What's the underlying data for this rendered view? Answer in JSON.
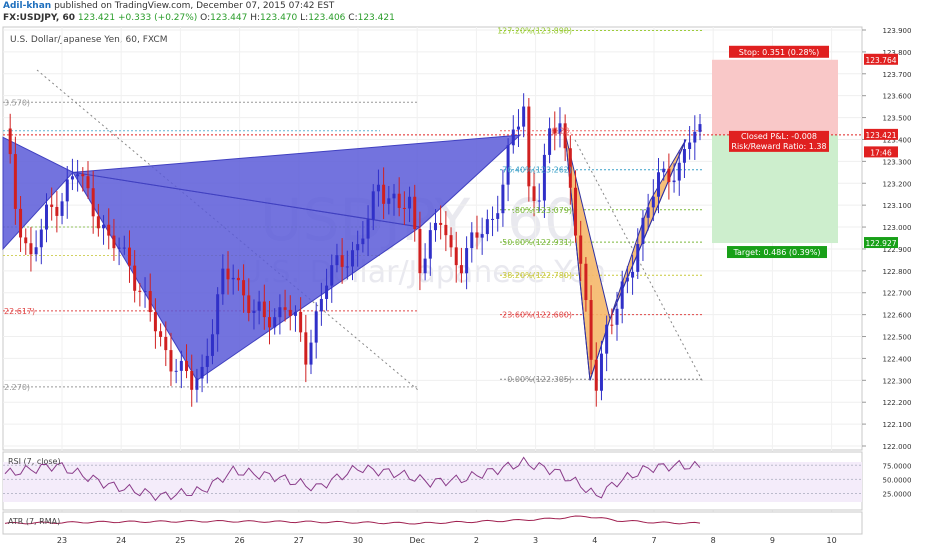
{
  "header": {
    "author": "Adil-khan",
    "published": "published on TradingView.com, December 07, 2015 07:42 EST",
    "symbol": "FX:USDJPY, 60",
    "last": "123.421",
    "change": "+0.333 (+0.27%)",
    "o_label": "O:",
    "o_value": "123.447",
    "h_label": "H:",
    "h_value": "123.470",
    "l_label": "L:",
    "l_value": "123.406",
    "c_label": "C:",
    "c_value": "123.421"
  },
  "chart_title": "U.S. Dollar/Japanese Yen, 60, FXCM",
  "watermark": {
    "symbol": "USDJPY, 60",
    "name": "U.S. Dollar/Japanese Yen"
  },
  "colors": {
    "up": "#3030c8",
    "down": "#d02020",
    "pattern_fill": "#5a5ad8",
    "pattern2_fill": "#f5b86a",
    "stop_zone": "#f9c8c8",
    "target_zone": "#cdeecd",
    "price_line": "#e02020",
    "rsi": "#8a3c8a",
    "atr": "#a02050"
  },
  "price_axis": {
    "ticks": [
      "123.900",
      "123.800",
      "123.700",
      "123.600",
      "123.500",
      "123.400",
      "123.300",
      "123.200",
      "123.100",
      "123.000",
      "122.900",
      "122.800",
      "122.700",
      "122.600",
      "122.500",
      "122.400",
      "122.300",
      "122.200",
      "122.100",
      "122.000"
    ],
    "current_price": "123.421",
    "countdown": "17:46",
    "stop_price": "123.764",
    "target_price": "122.927"
  },
  "time_axis": [
    "23",
    "24",
    "25",
    "26",
    "27",
    "30",
    "Dec",
    "2",
    "3",
    "4",
    "7",
    "8",
    "9",
    "10"
  ],
  "left_fib_levels": [
    "3.570)",
    "22.617)",
    "2.270)"
  ],
  "fib_levels": [
    "127.20%(123.898)",
    "(123.",
    "76.40%(123.262)",
    ".80%(123.079)",
    "50.00%(122.931)",
    "38.20%(122.780)",
    "23.60%(122.600)",
    "0.00%(122.305)"
  ],
  "trade_labels": {
    "stop": "Stop: 0.351 (0.28%)",
    "closed_pnl": "Closed P&L: -0.008",
    "risk_reward": "Risk/Reward Ratio: 1.38",
    "target": "Target: 0.486 (0.39%)"
  },
  "rsi_panel": {
    "label": "RSI (7, close)",
    "ticks": [
      "75.0000",
      "50.0000",
      "25.0000"
    ]
  },
  "atr_panel": {
    "label": "ATR (7, RMA)"
  },
  "chart_data": {
    "type": "candlestick",
    "title": "U.S. Dollar/Japanese Yen, 60, FXCM",
    "ylim": [
      122.0,
      123.9
    ],
    "x_labels": [
      "23",
      "24",
      "25",
      "26",
      "27",
      "30",
      "Dec",
      "2",
      "3",
      "4",
      "7",
      "8",
      "9",
      "10"
    ],
    "price_path": [
      [
        0,
        123.45
      ],
      [
        2,
        123.1
      ],
      [
        5,
        122.85
      ],
      [
        8,
        123.05
      ],
      [
        11,
        123.15
      ],
      [
        14,
        123.25
      ],
      [
        16,
        123.15
      ],
      [
        18,
        123.05
      ],
      [
        20,
        122.92
      ],
      [
        22,
        122.9
      ],
      [
        24,
        122.85
      ],
      [
        26,
        122.7
      ],
      [
        28,
        122.6
      ],
      [
        30,
        122.48
      ],
      [
        32,
        122.4
      ],
      [
        34,
        122.33
      ],
      [
        36,
        122.28
      ],
      [
        38,
        122.35
      ],
      [
        40,
        122.55
      ],
      [
        42,
        122.75
      ],
      [
        44,
        122.8
      ],
      [
        46,
        122.7
      ],
      [
        48,
        122.6
      ],
      [
        50,
        122.58
      ],
      [
        52,
        122.6
      ],
      [
        54,
        122.65
      ],
      [
        56,
        122.55
      ],
      [
        58,
        122.42
      ],
      [
        60,
        122.6
      ],
      [
        62,
        122.75
      ],
      [
        64,
        122.82
      ],
      [
        66,
        122.88
      ],
      [
        68,
        122.9
      ],
      [
        70,
        123.02
      ],
      [
        72,
        123.2
      ],
      [
        74,
        123.15
      ],
      [
        76,
        123.08
      ],
      [
        78,
        123.1
      ],
      [
        80,
        122.85
      ],
      [
        82,
        122.95
      ],
      [
        84,
        123.02
      ],
      [
        86,
        122.88
      ],
      [
        88,
        122.85
      ],
      [
        90,
        122.92
      ],
      [
        92,
        122.98
      ],
      [
        94,
        123.05
      ],
      [
        96,
        123.2
      ],
      [
        98,
        123.42
      ],
      [
        100,
        123.55
      ],
      [
        101,
        123.18
      ],
      [
        103,
        123.15
      ],
      [
        105,
        123.4
      ],
      [
        107,
        123.5
      ],
      [
        109,
        123.2
      ],
      [
        111,
        122.8
      ],
      [
        113,
        122.4
      ],
      [
        114,
        122.3
      ],
      [
        116,
        122.55
      ],
      [
        118,
        122.62
      ],
      [
        120,
        122.75
      ],
      [
        122,
        122.95
      ],
      [
        124,
        123.1
      ],
      [
        126,
        123.2
      ],
      [
        128,
        123.25
      ],
      [
        130,
        123.28
      ],
      [
        132,
        123.4
      ],
      [
        134,
        123.42
      ]
    ],
    "rsi_path": [
      [
        0,
        60
      ],
      [
        10,
        75
      ],
      [
        20,
        40
      ],
      [
        30,
        20
      ],
      [
        38,
        30
      ],
      [
        44,
        65
      ],
      [
        52,
        55
      ],
      [
        60,
        35
      ],
      [
        68,
        70
      ],
      [
        76,
        60
      ],
      [
        82,
        45
      ],
      [
        88,
        50
      ],
      [
        96,
        70
      ],
      [
        100,
        80
      ],
      [
        106,
        65
      ],
      [
        111,
        40
      ],
      [
        114,
        20
      ],
      [
        118,
        45
      ],
      [
        124,
        70
      ],
      [
        130,
        75
      ],
      [
        134,
        72
      ]
    ],
    "atr_path": [
      [
        0,
        12
      ],
      [
        20,
        14
      ],
      [
        40,
        15
      ],
      [
        60,
        14
      ],
      [
        80,
        12
      ],
      [
        98,
        16
      ],
      [
        104,
        18
      ],
      [
        112,
        22
      ],
      [
        118,
        16
      ],
      [
        126,
        13
      ],
      [
        134,
        12
      ]
    ]
  }
}
